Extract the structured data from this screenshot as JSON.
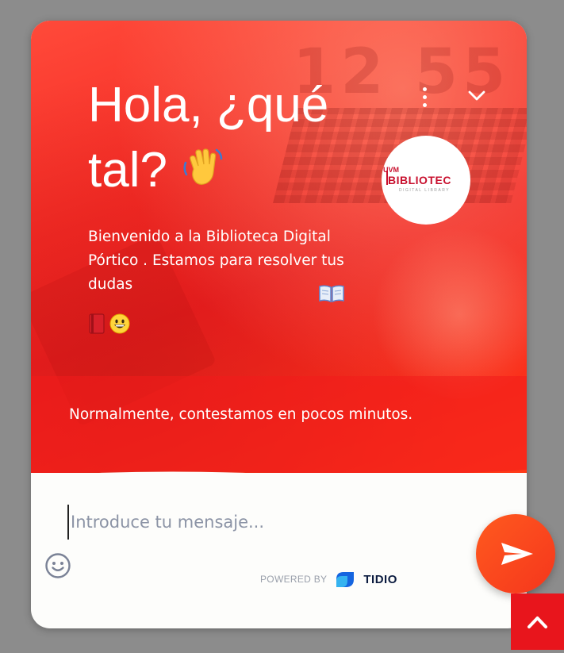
{
  "header": {
    "title_line1": "Hola, ¿qué",
    "title_line2": "tal?",
    "title_emoji": "waving-hand-emoji",
    "welcome_text": "Bienvenido a la Biblioteca Digital Pórtico . Estamos para resolver tus dudas",
    "welcome_emojis": [
      "open-book-emoji",
      "closed-book-emoji",
      "grinning-face-emoji"
    ],
    "reply_time": "Normalmente, contestamos en pocos minutos.",
    "background_photo_clock": "12 55"
  },
  "logo": {
    "tag": "UVM",
    "name": "BIBLIOTEC",
    "subtitle": "DIGITAL LIBRARY"
  },
  "controls": {
    "menu_icon": "vertical-dots-icon",
    "collapse_icon": "chevron-down-icon"
  },
  "composer": {
    "placeholder": "Introduce tu mensaje...",
    "emoji_icon": "smiley-icon",
    "send_icon": "paper-plane-icon"
  },
  "branding": {
    "powered_by": "POWERED BY",
    "brand": "TIDIO",
    "brand_icon": "tidio-logo-icon"
  },
  "scroll_top": {
    "icon": "chevron-up-icon"
  },
  "colors": {
    "header_red": "#f52a24",
    "accent_orange": "#ff5a1f",
    "scroll_top_red": "#e8151c",
    "panel_bg": "#fdfdfb",
    "page_bg": "#8c8c8c",
    "tidio_blue": "#1a73e8"
  }
}
